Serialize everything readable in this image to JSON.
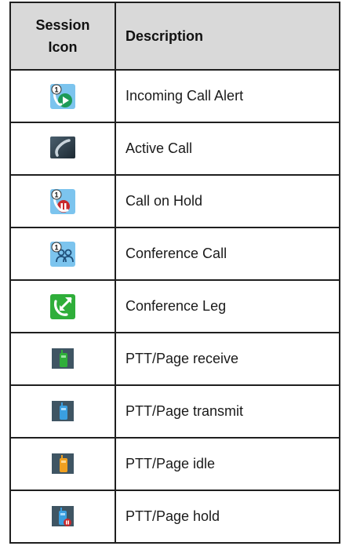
{
  "table": {
    "headers": {
      "icon_line1": "Session",
      "icon_line2": "Icon",
      "description": "Description"
    },
    "rows": [
      {
        "icon": "incoming-call-alert-icon",
        "description": "Incoming Call Alert",
        "badge": "1"
      },
      {
        "icon": "active-call-icon",
        "description": "Active Call"
      },
      {
        "icon": "call-on-hold-icon",
        "description": "Call on Hold",
        "badge": "1"
      },
      {
        "icon": "conference-call-icon",
        "description": "Conference Call",
        "badge": "1"
      },
      {
        "icon": "conference-leg-icon",
        "description": "Conference Leg"
      },
      {
        "icon": "ptt-page-receive-icon",
        "description": "PTT/Page receive"
      },
      {
        "icon": "ptt-page-transmit-icon",
        "description": "PTT/Page transmit"
      },
      {
        "icon": "ptt-page-idle-icon",
        "description": "PTT/Page idle"
      },
      {
        "icon": "ptt-page-hold-icon",
        "description": "PTT/Page hold"
      }
    ]
  },
  "colors": {
    "header_bg": "#d9d9d9",
    "border": "#1f1f1f",
    "icon_blue": "#2a7fc8",
    "icon_green": "#2fae3a",
    "icon_hold_red": "#c8282c",
    "icon_idle_orange": "#f0a020"
  }
}
